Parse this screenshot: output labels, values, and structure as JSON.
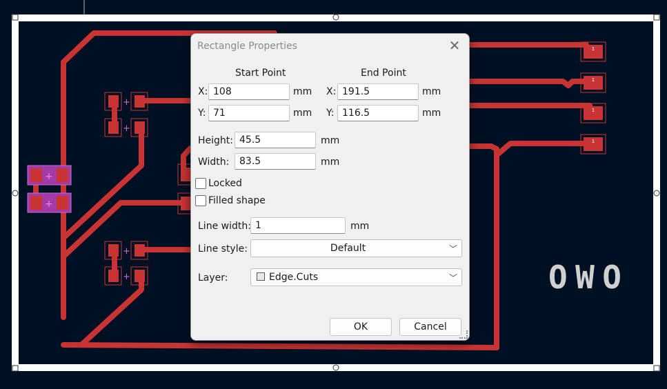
{
  "colors": {
    "board_bg": "#001023",
    "edge_cuts": "#ffffff",
    "copper": "#c83434",
    "pad_selected": "#a33aa8",
    "silkscreen": "#d0d0d0"
  },
  "pcb": {
    "silkscreen_text": "OWO",
    "pad_labels": [
      "1",
      "1",
      "1",
      "1"
    ]
  },
  "dialog": {
    "title": "Rectangle Properties",
    "close_icon": "close-icon",
    "start_point": {
      "header": "Start Point",
      "x_label": "X:",
      "x_value": "108",
      "y_label": "Y:",
      "y_value": "71",
      "unit": "mm"
    },
    "end_point": {
      "header": "End Point",
      "x_label": "X:",
      "x_value": "191.5",
      "y_label": "Y:",
      "y_value": "116.5",
      "unit": "mm"
    },
    "height": {
      "label": "Height:",
      "value": "45.5",
      "unit": "mm"
    },
    "width": {
      "label": "Width:",
      "value": "83.5",
      "unit": "mm"
    },
    "locked": {
      "label": "Locked",
      "checked": false
    },
    "filled_shape": {
      "label": "Filled shape",
      "checked": false
    },
    "line_width": {
      "label": "Line width:",
      "value": "1",
      "unit": "mm"
    },
    "line_style": {
      "label": "Line style:",
      "value": "Default"
    },
    "layer": {
      "label": "Layer:",
      "value": "Edge.Cuts"
    },
    "ok_label": "OK",
    "cancel_label": "Cancel"
  }
}
